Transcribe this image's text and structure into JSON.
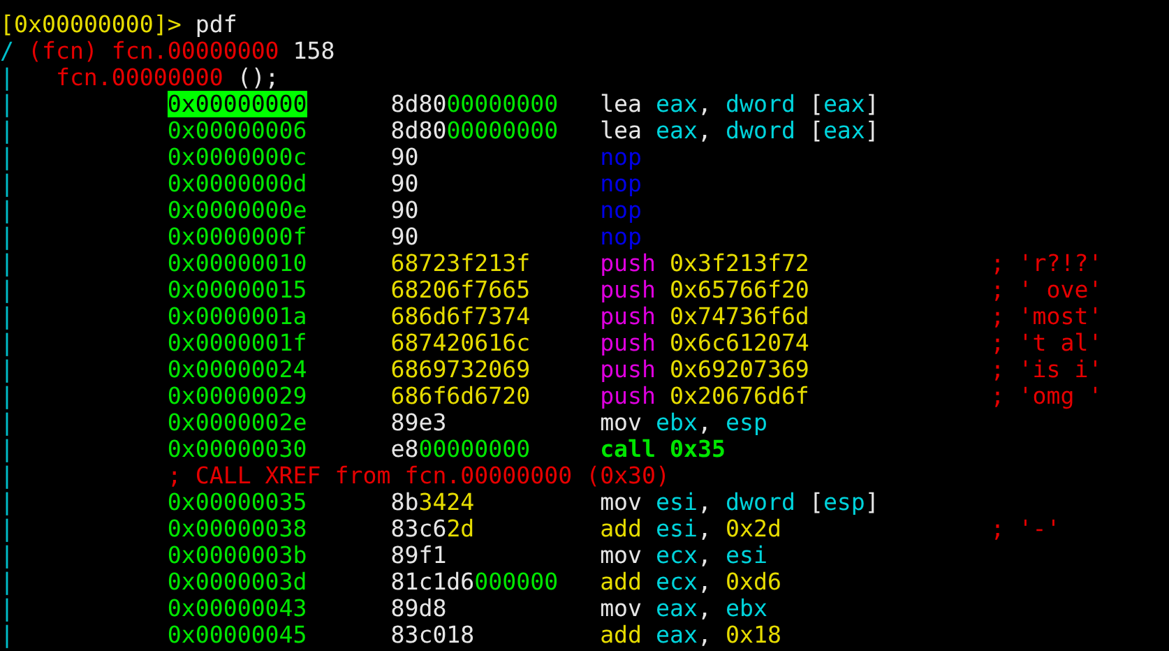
{
  "prompt": {
    "address": "[0x00000000]>",
    "command": "pdf"
  },
  "function_header": {
    "gutter": "/",
    "label": "(fcn) fcn.00000000",
    "size": "158"
  },
  "signature": {
    "gutter": "|",
    "name": "fcn.00000000",
    "args": "();"
  },
  "lines": [
    {
      "kind": "instruction",
      "gutter": "|",
      "selected": true,
      "address": "0x00000000",
      "bytes": [
        {
          "kind": "op",
          "text": "8d80"
        },
        {
          "kind": "zero",
          "text": "00000000"
        }
      ],
      "asm": [
        {
          "kind": "op",
          "text": "lea "
        },
        {
          "kind": "reg",
          "text": "eax"
        },
        {
          "kind": "op",
          "text": ", "
        },
        {
          "kind": "reg",
          "text": "dword"
        },
        {
          "kind": "op",
          "text": " ["
        },
        {
          "kind": "reg",
          "text": "eax"
        },
        {
          "kind": "op",
          "text": "]"
        }
      ]
    },
    {
      "kind": "instruction",
      "gutter": "|",
      "selected": false,
      "address": "0x00000006",
      "bytes": [
        {
          "kind": "op",
          "text": "8d80"
        },
        {
          "kind": "zero",
          "text": "00000000"
        }
      ],
      "asm": [
        {
          "kind": "op",
          "text": "lea "
        },
        {
          "kind": "reg",
          "text": "eax"
        },
        {
          "kind": "op",
          "text": ", "
        },
        {
          "kind": "reg",
          "text": "dword"
        },
        {
          "kind": "op",
          "text": " ["
        },
        {
          "kind": "reg",
          "text": "eax"
        },
        {
          "kind": "op",
          "text": "]"
        }
      ]
    },
    {
      "kind": "instruction",
      "gutter": "|",
      "selected": false,
      "address": "0x0000000c",
      "bytes": [
        {
          "kind": "op",
          "text": "90"
        }
      ],
      "asm": [
        {
          "kind": "nop",
          "text": "nop"
        }
      ]
    },
    {
      "kind": "instruction",
      "gutter": "|",
      "selected": false,
      "address": "0x0000000d",
      "bytes": [
        {
          "kind": "op",
          "text": "90"
        }
      ],
      "asm": [
        {
          "kind": "nop",
          "text": "nop"
        }
      ]
    },
    {
      "kind": "instruction",
      "gutter": "|",
      "selected": false,
      "address": "0x0000000e",
      "bytes": [
        {
          "kind": "op",
          "text": "90"
        }
      ],
      "asm": [
        {
          "kind": "nop",
          "text": "nop"
        }
      ]
    },
    {
      "kind": "instruction",
      "gutter": "|",
      "selected": false,
      "address": "0x0000000f",
      "bytes": [
        {
          "kind": "op",
          "text": "90"
        }
      ],
      "asm": [
        {
          "kind": "nop",
          "text": "nop"
        }
      ]
    },
    {
      "kind": "instruction",
      "gutter": "|",
      "selected": false,
      "address": "0x00000010",
      "bytes": [
        {
          "kind": "imm",
          "text": "68723f213f"
        }
      ],
      "asm": [
        {
          "kind": "push",
          "text": "push "
        },
        {
          "kind": "imm",
          "text": "0x3f213f72"
        }
      ],
      "comment": "; 'r?!?'"
    },
    {
      "kind": "instruction",
      "gutter": "|",
      "selected": false,
      "address": "0x00000015",
      "bytes": [
        {
          "kind": "imm",
          "text": "68206f7665"
        }
      ],
      "asm": [
        {
          "kind": "push",
          "text": "push "
        },
        {
          "kind": "imm",
          "text": "0x65766f20"
        }
      ],
      "comment": "; ' ove'"
    },
    {
      "kind": "instruction",
      "gutter": "|",
      "selected": false,
      "address": "0x0000001a",
      "bytes": [
        {
          "kind": "imm",
          "text": "686d6f7374"
        }
      ],
      "asm": [
        {
          "kind": "push",
          "text": "push "
        },
        {
          "kind": "imm",
          "text": "0x74736f6d"
        }
      ],
      "comment": "; 'most'"
    },
    {
      "kind": "instruction",
      "gutter": "|",
      "selected": false,
      "address": "0x0000001f",
      "bytes": [
        {
          "kind": "imm",
          "text": "687420616c"
        }
      ],
      "asm": [
        {
          "kind": "push",
          "text": "push "
        },
        {
          "kind": "imm",
          "text": "0x6c612074"
        }
      ],
      "comment": "; 't al'"
    },
    {
      "kind": "instruction",
      "gutter": "|",
      "selected": false,
      "address": "0x00000024",
      "bytes": [
        {
          "kind": "imm",
          "text": "6869732069"
        }
      ],
      "asm": [
        {
          "kind": "push",
          "text": "push "
        },
        {
          "kind": "imm",
          "text": "0x69207369"
        }
      ],
      "comment": "; 'is i'"
    },
    {
      "kind": "instruction",
      "gutter": "|",
      "selected": false,
      "address": "0x00000029",
      "bytes": [
        {
          "kind": "imm",
          "text": "686f6d6720"
        }
      ],
      "asm": [
        {
          "kind": "push",
          "text": "push "
        },
        {
          "kind": "imm",
          "text": "0x20676d6f"
        }
      ],
      "comment": "; 'omg '"
    },
    {
      "kind": "instruction",
      "gutter": "|",
      "selected": false,
      "address": "0x0000002e",
      "bytes": [
        {
          "kind": "op",
          "text": "89e3"
        }
      ],
      "asm": [
        {
          "kind": "op",
          "text": "mov "
        },
        {
          "kind": "reg",
          "text": "ebx"
        },
        {
          "kind": "op",
          "text": ", "
        },
        {
          "kind": "reg",
          "text": "esp"
        }
      ]
    },
    {
      "kind": "instruction",
      "gutter": "|",
      "selected": false,
      "address": "0x00000030",
      "bytes": [
        {
          "kind": "op",
          "text": "e8"
        },
        {
          "kind": "zero",
          "text": "00000000"
        }
      ],
      "asm": [
        {
          "kind": "call",
          "text": "call 0x35"
        }
      ]
    },
    {
      "kind": "xref",
      "gutter": "|",
      "text": "; CALL XREF from fcn.00000000 (0x30)"
    },
    {
      "kind": "instruction",
      "gutter": "|",
      "selected": false,
      "address": "0x00000035",
      "bytes": [
        {
          "kind": "op",
          "text": "8b"
        },
        {
          "kind": "imm",
          "text": "3424"
        }
      ],
      "asm": [
        {
          "kind": "op",
          "text": "mov "
        },
        {
          "kind": "reg",
          "text": "esi"
        },
        {
          "kind": "op",
          "text": ", "
        },
        {
          "kind": "reg",
          "text": "dword"
        },
        {
          "kind": "op",
          "text": " ["
        },
        {
          "kind": "reg",
          "text": "esp"
        },
        {
          "kind": "op",
          "text": "]"
        }
      ]
    },
    {
      "kind": "instruction",
      "gutter": "|",
      "selected": false,
      "address": "0x00000038",
      "bytes": [
        {
          "kind": "op",
          "text": "83c6"
        },
        {
          "kind": "imm",
          "text": "2d"
        }
      ],
      "asm": [
        {
          "kind": "imm",
          "text": "add "
        },
        {
          "kind": "reg",
          "text": "esi"
        },
        {
          "kind": "op",
          "text": ", "
        },
        {
          "kind": "imm",
          "text": "0x2d"
        }
      ],
      "comment": "; '-'"
    },
    {
      "kind": "instruction",
      "gutter": "|",
      "selected": false,
      "address": "0x0000003b",
      "bytes": [
        {
          "kind": "op",
          "text": "89f1"
        }
      ],
      "asm": [
        {
          "kind": "op",
          "text": "mov "
        },
        {
          "kind": "reg",
          "text": "ecx"
        },
        {
          "kind": "op",
          "text": ", "
        },
        {
          "kind": "reg",
          "text": "esi"
        }
      ]
    },
    {
      "kind": "instruction",
      "gutter": "|",
      "selected": false,
      "address": "0x0000003d",
      "bytes": [
        {
          "kind": "op",
          "text": "81c1d6"
        },
        {
          "kind": "zero",
          "text": "000000"
        }
      ],
      "asm": [
        {
          "kind": "imm",
          "text": "add "
        },
        {
          "kind": "reg",
          "text": "ecx"
        },
        {
          "kind": "op",
          "text": ", "
        },
        {
          "kind": "imm",
          "text": "0xd6"
        }
      ]
    },
    {
      "kind": "instruction",
      "gutter": "|",
      "selected": false,
      "address": "0x00000043",
      "bytes": [
        {
          "kind": "op",
          "text": "89d8"
        }
      ],
      "asm": [
        {
          "kind": "op",
          "text": "mov "
        },
        {
          "kind": "reg",
          "text": "eax"
        },
        {
          "kind": "op",
          "text": ", "
        },
        {
          "kind": "reg",
          "text": "ebx"
        }
      ]
    },
    {
      "kind": "instruction",
      "gutter": "|",
      "selected": false,
      "address": "0x00000045",
      "bytes": [
        {
          "kind": "op",
          "text": "83c018"
        }
      ],
      "asm": [
        {
          "kind": "imm",
          "text": "add "
        },
        {
          "kind": "reg",
          "text": "eax"
        },
        {
          "kind": "op",
          "text": ", "
        },
        {
          "kind": "imm",
          "text": "0x18"
        }
      ]
    }
  ]
}
